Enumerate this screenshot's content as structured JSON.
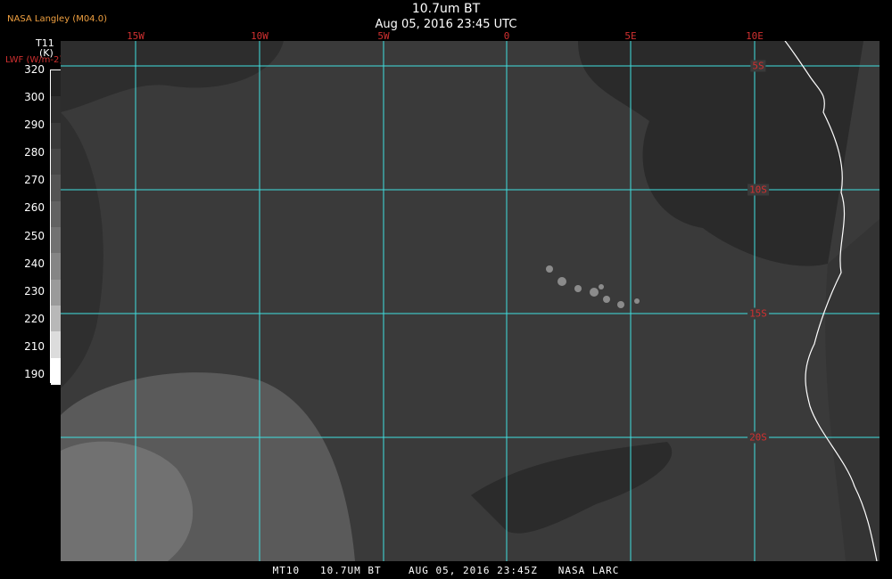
{
  "header": {
    "title": "10.7um BT",
    "subtitle": "Aug 05, 2016 23:45 UTC",
    "provider": "NASA Langley (M04.0)"
  },
  "colorbar": {
    "variable": "T11",
    "unit": "(K)",
    "alt_label": "LWF (W/m-2)",
    "ticks": [
      "320",
      "300",
      "290",
      "280",
      "270",
      "260",
      "250",
      "240",
      "230",
      "220",
      "210",
      "190"
    ],
    "colors": [
      "#222222",
      "#2e2e2e",
      "#3a3a3a",
      "#474747",
      "#545454",
      "#626262",
      "#727272",
      "#858585",
      "#9a9a9a",
      "#b8b8b8",
      "#dcdcdc",
      "#ffffff"
    ]
  },
  "map": {
    "longitude_labels": [
      "15W",
      "10W",
      "5W",
      "0",
      "5E",
      "10E"
    ],
    "latitude_labels": [
      "5S",
      "10S",
      "15S",
      "20S"
    ],
    "colors": {
      "ocean": "#3a3a3a",
      "cloud_dark": "#262626",
      "cloud_light": "#6e6e6e",
      "land": "#2a2a2a",
      "grid": "#40e0e0",
      "coast": "#ffffff",
      "label": "#d03030"
    }
  },
  "footer": {
    "caption": "MT10   10.7UM BT    AUG 05, 2016 23:45Z   NASA LARC"
  }
}
